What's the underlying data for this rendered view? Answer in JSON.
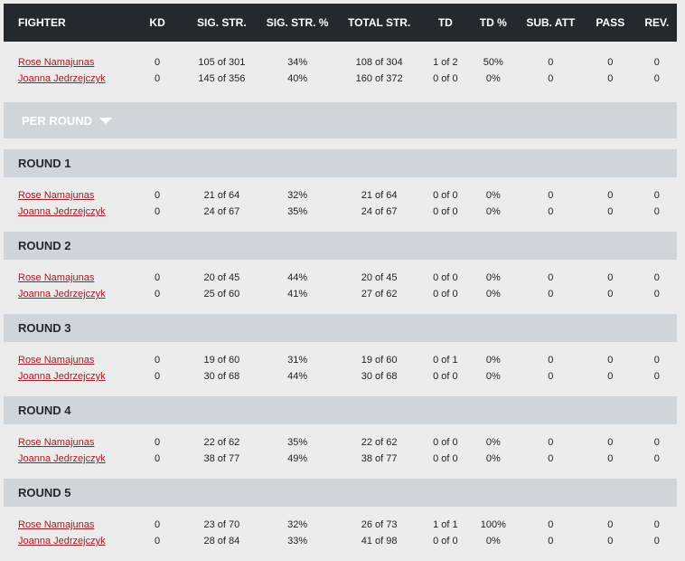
{
  "headers": [
    "FIGHTER",
    "KD",
    "SIG. STR.",
    "SIG. STR. %",
    "TOTAL STR.",
    "TD",
    "TD %",
    "SUB. ATT",
    "PASS",
    "REV."
  ],
  "totals": [
    {
      "fighter": "Rose Namajunas",
      "kd": "0",
      "sig_str": "105 of 301",
      "sig_pct": "34%",
      "total_str": "108 of 304",
      "td": "1 of 2",
      "td_pct": "50%",
      "sub_att": "0",
      "pass": "0",
      "rev": "0"
    },
    {
      "fighter": "Joanna Jedrzejczyk",
      "kd": "0",
      "sig_str": "145 of 356",
      "sig_pct": "40%",
      "total_str": "160 of 372",
      "td": "0 of 0",
      "td_pct": "0%",
      "sub_att": "0",
      "pass": "0",
      "rev": "0"
    }
  ],
  "per_round_label": "PER ROUND",
  "rounds": [
    {
      "title": "ROUND 1",
      "rows": [
        {
          "fighter": "Rose Namajunas",
          "kd": "0",
          "sig_str": "21 of 64",
          "sig_pct": "32%",
          "total_str": "21 of 64",
          "td": "0 of 0",
          "td_pct": "0%",
          "sub_att": "0",
          "pass": "0",
          "rev": "0"
        },
        {
          "fighter": "Joanna Jedrzejczyk",
          "kd": "0",
          "sig_str": "24 of 67",
          "sig_pct": "35%",
          "total_str": "24 of 67",
          "td": "0 of 0",
          "td_pct": "0%",
          "sub_att": "0",
          "pass": "0",
          "rev": "0"
        }
      ]
    },
    {
      "title": "ROUND 2",
      "rows": [
        {
          "fighter": "Rose Namajunas",
          "kd": "0",
          "sig_str": "20 of 45",
          "sig_pct": "44%",
          "total_str": "20 of 45",
          "td": "0 of 0",
          "td_pct": "0%",
          "sub_att": "0",
          "pass": "0",
          "rev": "0"
        },
        {
          "fighter": "Joanna Jedrzejczyk",
          "kd": "0",
          "sig_str": "25 of 60",
          "sig_pct": "41%",
          "total_str": "27 of 62",
          "td": "0 of 0",
          "td_pct": "0%",
          "sub_att": "0",
          "pass": "0",
          "rev": "0"
        }
      ]
    },
    {
      "title": "ROUND 3",
      "rows": [
        {
          "fighter": "Rose Namajunas",
          "kd": "0",
          "sig_str": "19 of 60",
          "sig_pct": "31%",
          "total_str": "19 of 60",
          "td": "0 of 1",
          "td_pct": "0%",
          "sub_att": "0",
          "pass": "0",
          "rev": "0"
        },
        {
          "fighter": "Joanna Jedrzejczyk",
          "kd": "0",
          "sig_str": "30 of 68",
          "sig_pct": "44%",
          "total_str": "30 of 68",
          "td": "0 of 0",
          "td_pct": "0%",
          "sub_att": "0",
          "pass": "0",
          "rev": "0"
        }
      ]
    },
    {
      "title": "ROUND 4",
      "rows": [
        {
          "fighter": "Rose Namajunas",
          "kd": "0",
          "sig_str": "22 of 62",
          "sig_pct": "35%",
          "total_str": "22 of 62",
          "td": "0 of 0",
          "td_pct": "0%",
          "sub_att": "0",
          "pass": "0",
          "rev": "0"
        },
        {
          "fighter": "Joanna Jedrzejczyk",
          "kd": "0",
          "sig_str": "38 of 77",
          "sig_pct": "49%",
          "total_str": "38 of 77",
          "td": "0 of 0",
          "td_pct": "0%",
          "sub_att": "0",
          "pass": "0",
          "rev": "0"
        }
      ]
    },
    {
      "title": "ROUND 5",
      "rows": [
        {
          "fighter": "Rose Namajunas",
          "kd": "0",
          "sig_str": "23 of 70",
          "sig_pct": "32%",
          "total_str": "26 of 73",
          "td": "1 of 1",
          "td_pct": "100%",
          "sub_att": "0",
          "pass": "0",
          "rev": "0"
        },
        {
          "fighter": "Joanna Jedrzejczyk",
          "kd": "0",
          "sig_str": "28 of 84",
          "sig_pct": "33%",
          "total_str": "41 of 98",
          "td": "0 of 0",
          "td_pct": "0%",
          "sub_att": "0",
          "pass": "0",
          "rev": "0"
        }
      ]
    }
  ],
  "colors": {
    "header_bg": "#23292f",
    "round_bg": "#d0d5db",
    "link": "#b0161e",
    "page_bg": "#ececec"
  }
}
